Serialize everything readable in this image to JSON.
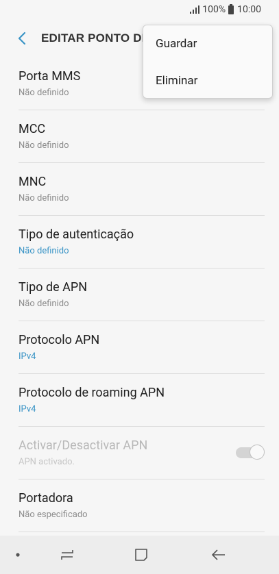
{
  "status_bar": {
    "battery_percent": "100%",
    "time": "10:00",
    "icons": [
      "signal-icon",
      "battery-icon"
    ]
  },
  "app_bar": {
    "title": "EDITAR PONTO DE",
    "back_icon": "back-arrow-icon"
  },
  "menu": {
    "items": [
      {
        "label": "Guardar"
      },
      {
        "label": "Eliminar"
      }
    ]
  },
  "settings": [
    {
      "title": "Porta MMS",
      "subtitle": "Não definido"
    },
    {
      "title": "MCC",
      "subtitle": "Não definido"
    },
    {
      "title": "MNC",
      "subtitle": "Não definido"
    },
    {
      "title": "Tipo de autenticação",
      "subtitle": "Não definido"
    },
    {
      "title": "Tipo de APN",
      "subtitle": "Não definido"
    },
    {
      "title": "Protocolo APN",
      "subtitle": "IPv4"
    },
    {
      "title": "Protocolo de roaming APN",
      "subtitle": "IPv4"
    },
    {
      "title": "Activar/Desactivar APN",
      "subtitle": "APN activado.",
      "toggle_on": true,
      "disabled": true
    },
    {
      "title": "Portadora",
      "subtitle": "Não especificado"
    }
  ],
  "nav_bar": {
    "icons": [
      "dot-icon",
      "recent-apps-icon",
      "home-icon",
      "back-icon"
    ]
  },
  "colors": {
    "accent": "#3a94c6",
    "background": "#f6f6f6"
  }
}
